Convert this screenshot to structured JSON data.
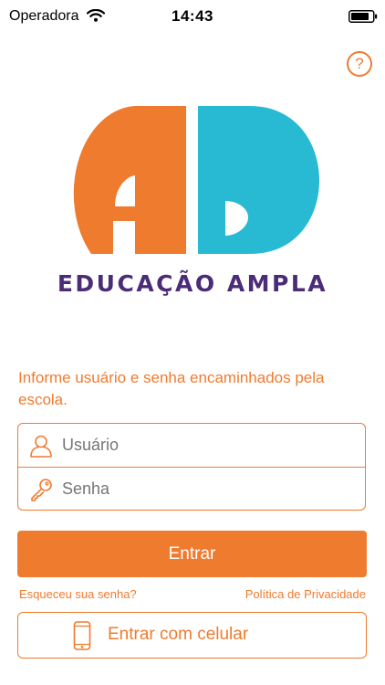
{
  "status_bar": {
    "carrier": "Operadora",
    "time": "14:43"
  },
  "colors": {
    "accent": "#ef7b2f",
    "logo_orange": "#ef7b2f",
    "logo_cyan": "#27bad2",
    "brand_purple": "#4a2c77"
  },
  "header": {
    "help_label": "?"
  },
  "brand": {
    "name": "EDUCAÇÃO AMPLA"
  },
  "login": {
    "instructions": "Informe usuário e senha encaminhados pela escola.",
    "username_placeholder": "Usuário",
    "password_placeholder": "Senha",
    "enter_label": "Entrar",
    "forgot_label": "Esqueceu sua senha?",
    "privacy_label": "Política de Privacidade",
    "cellphone_label": "Entrar com celular"
  },
  "icons": [
    "wifi-icon",
    "battery-icon",
    "help-icon",
    "user-icon",
    "key-icon",
    "phone-icon"
  ]
}
